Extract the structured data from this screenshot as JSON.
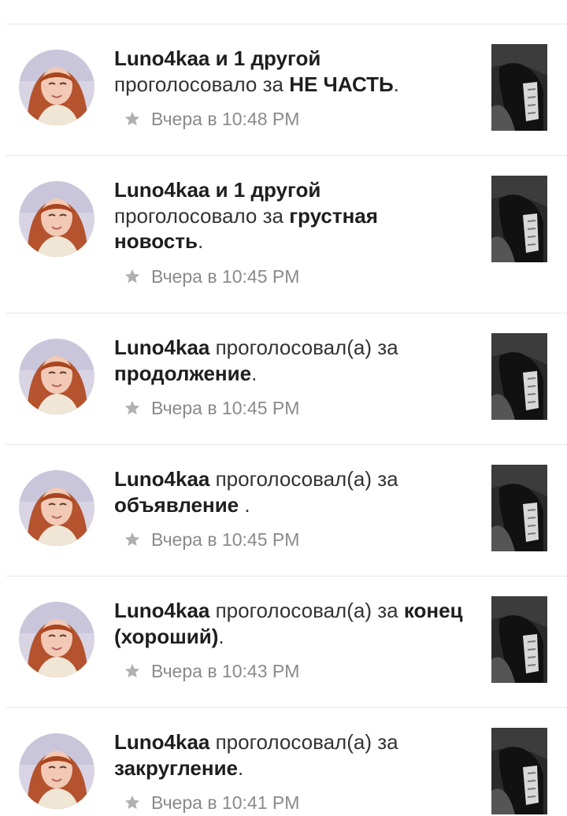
{
  "colors": {
    "divider": "#e6e6e6",
    "text": "#222222",
    "time": "#8a8a8a",
    "star": "#b0b0b0"
  },
  "icons": {
    "star": "star-icon"
  },
  "notifications": [
    {
      "user": "Luno4kaa",
      "action_prefix": " и 1 другой",
      "action": " проголосовало за ",
      "story": "НЕ ЧАСТЬ",
      "suffix": ".",
      "time": "Вчера в 10:48 PM"
    },
    {
      "user": "Luno4kaa",
      "action_prefix": " и 1 другой",
      "action": " проголосовало за ",
      "story": "грустная новость",
      "suffix": ".",
      "time": "Вчера в 10:45 PM"
    },
    {
      "user": "Luno4kaa",
      "action_prefix": "",
      "action": " проголосовал(а) за ",
      "story": "продолжение",
      "suffix": ".",
      "time": "Вчера в 10:45 PM"
    },
    {
      "user": "Luno4kaa",
      "action_prefix": "",
      "action": " проголосовал(а) за ",
      "story": "объявление ",
      "suffix": ".",
      "time": "Вчера в 10:45 PM"
    },
    {
      "user": "Luno4kaa",
      "action_prefix": "",
      "action": " проголосовал(а) за ",
      "story": "конец (хороший)",
      "suffix": ".",
      "time": "Вчера в 10:43 PM"
    },
    {
      "user": "Luno4kaa",
      "action_prefix": "",
      "action": " проголосовал(а) за ",
      "story": "закругление",
      "suffix": ".",
      "time": "Вчера в 10:41 PM"
    }
  ]
}
